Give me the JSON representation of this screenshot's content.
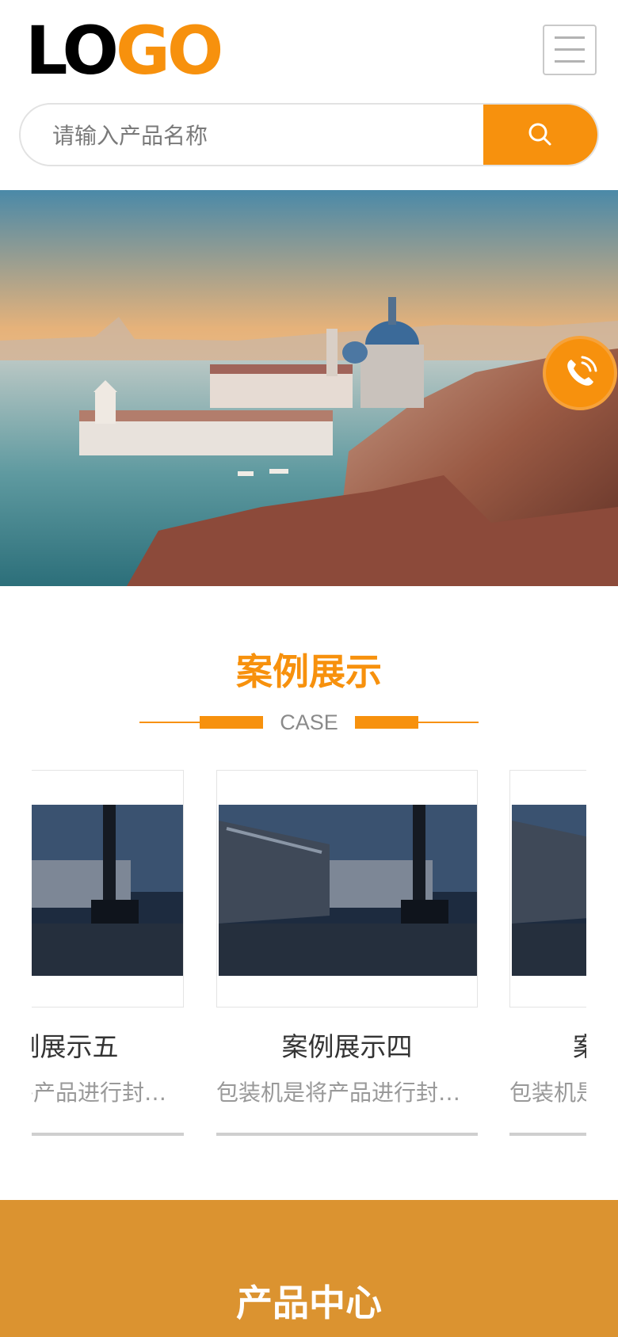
{
  "header": {
    "logo_left": "LO",
    "logo_right": "GO",
    "menu_icon": "hamburger-menu-icon"
  },
  "search": {
    "placeholder": "请输入产品名称",
    "button_icon": "search-icon"
  },
  "banner": {
    "image_subject": "venice-cityscape",
    "contact_icon": "phone-icon"
  },
  "cases_section": {
    "title": "案例展示",
    "subtitle": "CASE",
    "items": [
      {
        "title": "案例展示五",
        "desc": "包装机是将产品进行封…"
      },
      {
        "title": "案例展示四",
        "desc": "包装机是将产品进行封…"
      },
      {
        "title": "案例展示三",
        "desc": "包装机是将产品进行封…"
      }
    ]
  },
  "products_section": {
    "title": "产品中心"
  },
  "colors": {
    "accent": "#f7910d",
    "band": "#db9330"
  }
}
